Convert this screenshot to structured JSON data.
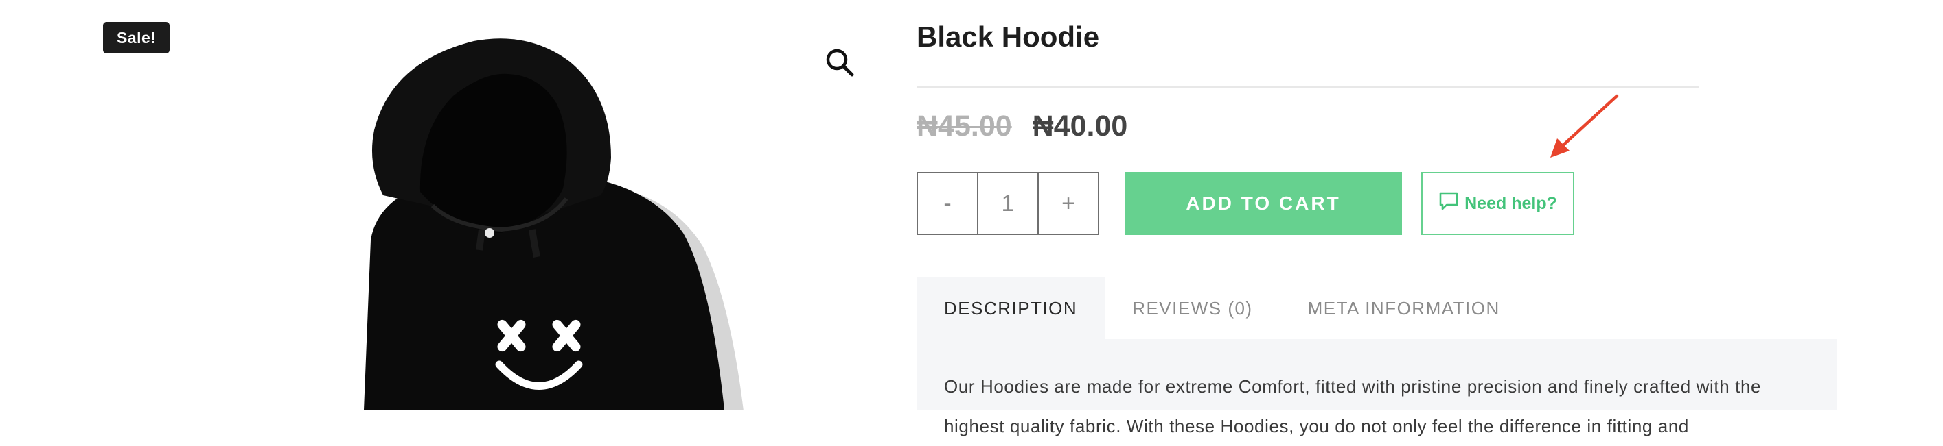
{
  "gallery": {
    "badge": "Sale!",
    "zoom_icon": "search-icon"
  },
  "product": {
    "title": "Black Hoodie",
    "price_old": "₦45.00",
    "price_new": "₦40.00",
    "qty_minus": "-",
    "qty_value": "1",
    "qty_plus": "+",
    "add_to_cart": "ADD TO CART",
    "need_help": "Need help?",
    "need_help_icon": "chat-bubble-icon"
  },
  "tabs": [
    {
      "label": "DESCRIPTION",
      "active": true
    },
    {
      "label": "REVIEWS (0)",
      "active": false
    },
    {
      "label": "META INFORMATION",
      "active": false
    }
  ],
  "description": "Our Hoodies are made for extreme Comfort, fitted with pristine precision and finely crafted with the highest quality fabric. With these Hoodies, you do not only feel the difference in fitting and",
  "colors": {
    "accent": "#66d18f",
    "badge": "#1c1c1c",
    "annotation_arrow": "#e8442c"
  }
}
